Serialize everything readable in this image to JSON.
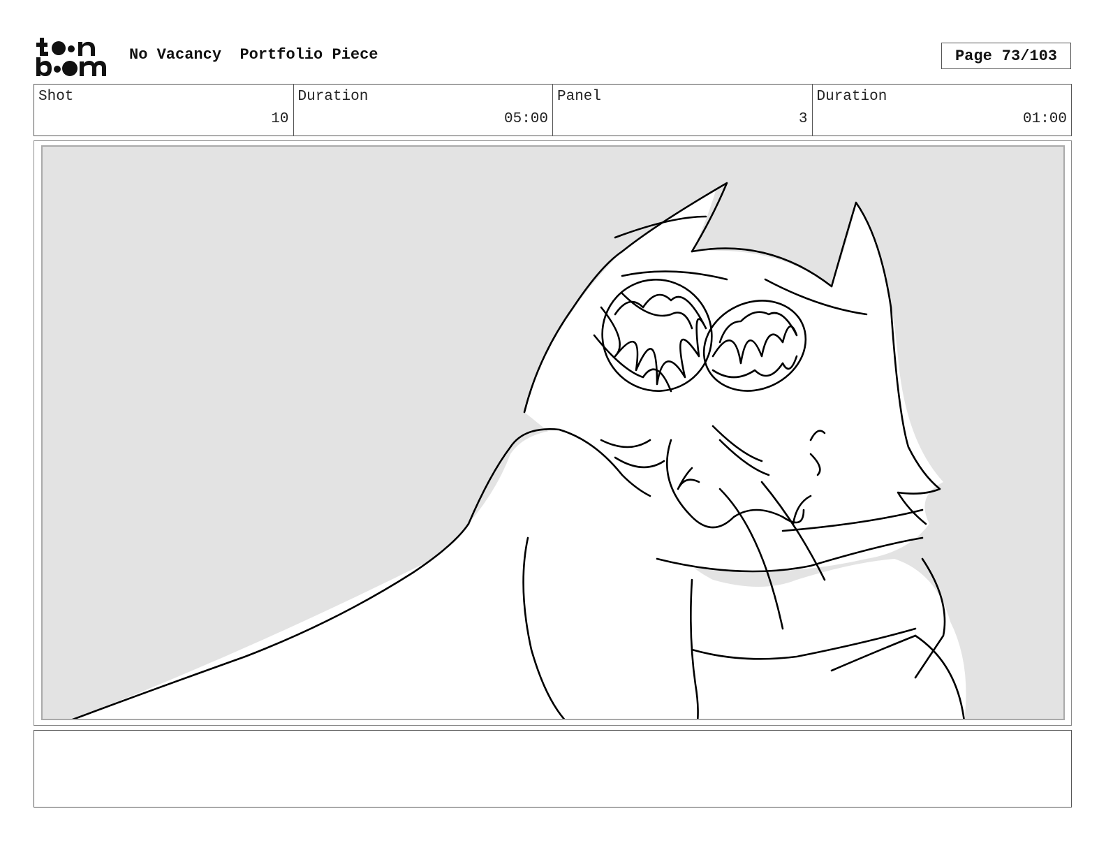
{
  "header": {
    "logo_text": "toonboom",
    "project": "No Vacancy",
    "subtitle": "Portfolio Piece",
    "page_label": "Page",
    "page_value": "73/103"
  },
  "info": {
    "shot_label": "Shot",
    "shot_value": "10",
    "shot_duration_label": "Duration",
    "shot_duration_value": "05:00",
    "panel_label": "Panel",
    "panel_value": "3",
    "panel_duration_label": "Duration",
    "panel_duration_value": "01:00"
  },
  "panel_image": {
    "description_icon": "storyboard-sketch-icon",
    "line_color": "#000000",
    "background_color": "#e3e3e3"
  },
  "notes": {
    "text": ""
  }
}
